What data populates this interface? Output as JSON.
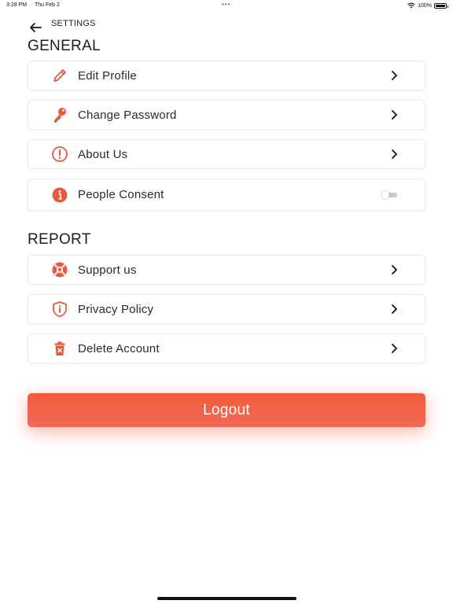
{
  "status_bar": {
    "time": "3:28 PM",
    "date": "Thu Feb 2",
    "dots": "•••",
    "battery": "100%"
  },
  "header": {
    "title": "SETTINGS",
    "back_icon": "arrow-left-icon"
  },
  "general": {
    "title": "GENERAL",
    "items": [
      {
        "label": "Edit Profile",
        "icon": "pencil-icon"
      },
      {
        "label": "Change Password",
        "icon": "key-icon"
      },
      {
        "label": "About Us",
        "icon": "exclamation-circle-icon"
      },
      {
        "label": "People Consent",
        "icon": "info-circle-icon",
        "toggle": false
      }
    ]
  },
  "report": {
    "title": "REPORT",
    "items": [
      {
        "label": "Support us",
        "icon": "lifebuoy-icon"
      },
      {
        "label": "Privacy Policy",
        "icon": "shield-info-icon"
      },
      {
        "label": "Delete Account",
        "icon": "trash-icon"
      }
    ]
  },
  "logout": {
    "label": "Logout"
  },
  "colors": {
    "accent": "#f05a3c",
    "text": "#2a2a2a",
    "border": "#ececec",
    "toggle_off": "#c9c9c9"
  }
}
